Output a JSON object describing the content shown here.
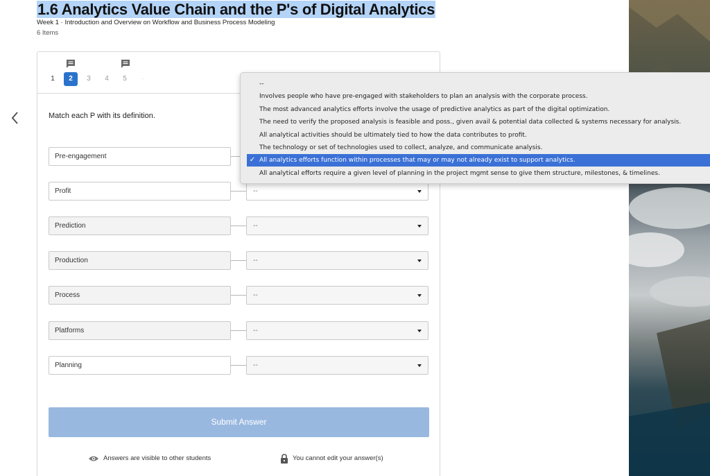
{
  "header": {
    "title": "1.6 Analytics Value Chain and the P's of Digital Analytics",
    "subtitle": "Week 1 · Introduction and Overview on Workflow and Business Process Modeling",
    "items_count": "6 Items"
  },
  "nav": {
    "prev_icon": "chevron-left-icon"
  },
  "question_nav": {
    "numbers": [
      "1",
      "2",
      "3",
      "4",
      "5"
    ],
    "active_number": "2",
    "comment_icon": "comment-icon",
    "overflow": "·"
  },
  "question": {
    "prompt": "Match each P with its definition.",
    "terms": [
      "Pre-engagement",
      "Profit",
      "Prediction",
      "Production",
      "Process",
      "Platforms",
      "Planning"
    ],
    "selected_values": [
      "--",
      "--",
      "--",
      "--",
      "--",
      "--",
      "--"
    ]
  },
  "dropdown": {
    "options": [
      "--",
      "Involves people who have pre-engaged with stakeholders to plan an analysis with the corporate process.",
      "The most advanced analytics efforts involve the usage of predictive analytics as part of the digital optimization.",
      "The need to verify the proposed analysis is feasible and poss., given avail & potential data collected & systems necessary for analysis.",
      "All analytical activities should be ultimately tied to how the data contributes to profit.",
      "The technology or set of technologies used to collect, analyze, and communicate analysis.",
      "All analytics efforts function within processes that may or may not already exist to support analytics.",
      "All analytical efforts require a given level of planning in the project mgmt sense to give them structure, milestones, & timelines."
    ],
    "selected_option": "All analytics efforts function within processes that may or may not already exist to support analytics.",
    "check_mark": "✓"
  },
  "actions": {
    "submit_label": "Submit Answer"
  },
  "footer": {
    "visibility_note": "Answers are visible to other students",
    "edit_note": "You cannot edit your answer(s)",
    "eye_icon": "eye-icon",
    "lock_icon": "lock-icon"
  },
  "colors": {
    "accent": "#2a73cc",
    "submit_disabled": "#99b8e0",
    "title_highlight": "#b3d3f7",
    "menu_highlight": "#3b71d6"
  }
}
